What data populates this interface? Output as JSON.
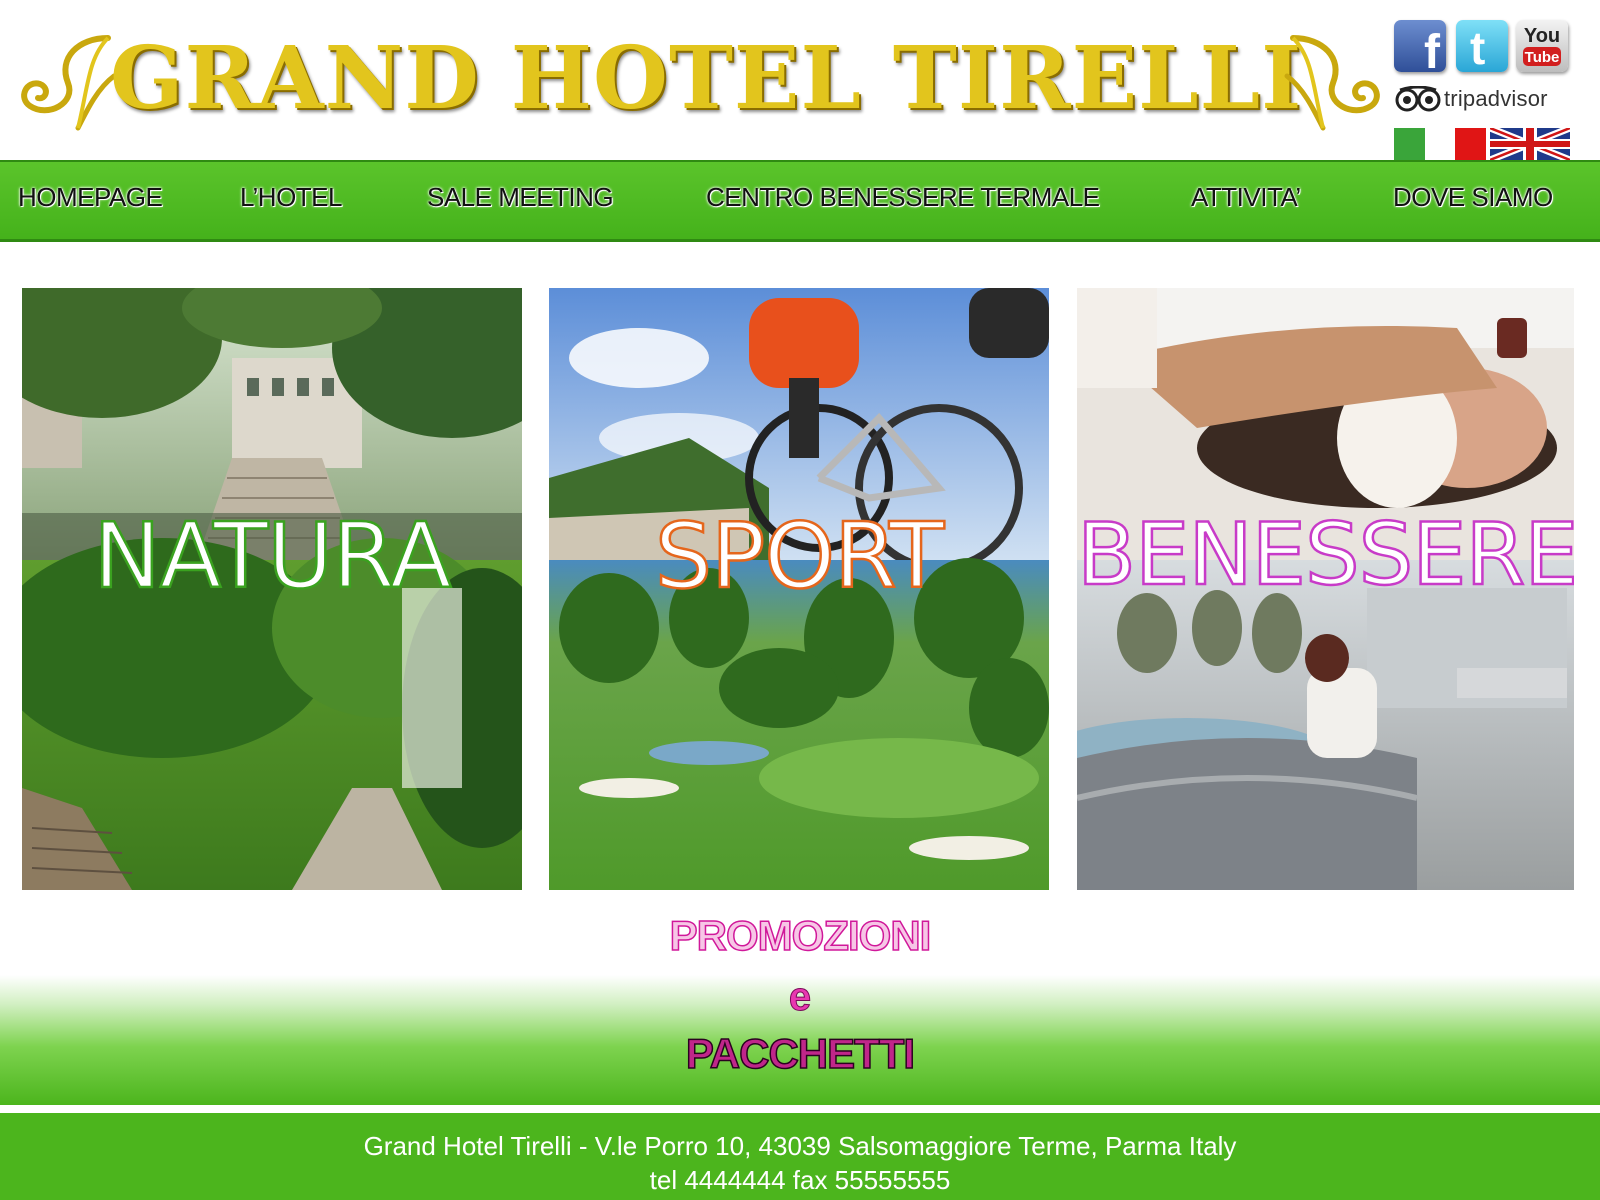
{
  "header": {
    "logo_text": "GRAND HOTEL TIRELLI",
    "logo_color": "#e2c51d",
    "social": [
      {
        "name": "facebook-icon",
        "glyph": "f"
      },
      {
        "name": "twitter-icon",
        "glyph": "t"
      },
      {
        "name": "youtube-icon",
        "line1": "You",
        "line2": "Tube"
      }
    ],
    "tripadvisor_text": "tripadvisor",
    "languages": [
      {
        "name": "italian-flag-icon"
      },
      {
        "name": "english-flag-icon"
      }
    ]
  },
  "nav": {
    "items": [
      {
        "label": "HOMEPAGE"
      },
      {
        "label": "L’HOTEL"
      },
      {
        "label": "SALE MEETING"
      },
      {
        "label": "CENTRO BENESSERE TERMALE"
      },
      {
        "label": "ATTIVITA’"
      },
      {
        "label": "DOVE SIAMO"
      }
    ],
    "color": "#4cb51d"
  },
  "tiles": [
    {
      "label": "NATURA",
      "stroke_color": "#3aa21f"
    },
    {
      "label": "SPORT",
      "stroke_color": "#e5661c"
    },
    {
      "label": "BENESSERE",
      "stroke_color": "#c83bc8"
    }
  ],
  "promo": {
    "line1": "PROMOZIONI",
    "line2": "e",
    "line3": "PACCHETTI"
  },
  "footer": {
    "line1": "Grand Hotel Tirelli - V.le Porro 10, 43039 Salsomaggiore Terme, Parma Italy",
    "line2": "tel 4444444 fax 55555555"
  }
}
